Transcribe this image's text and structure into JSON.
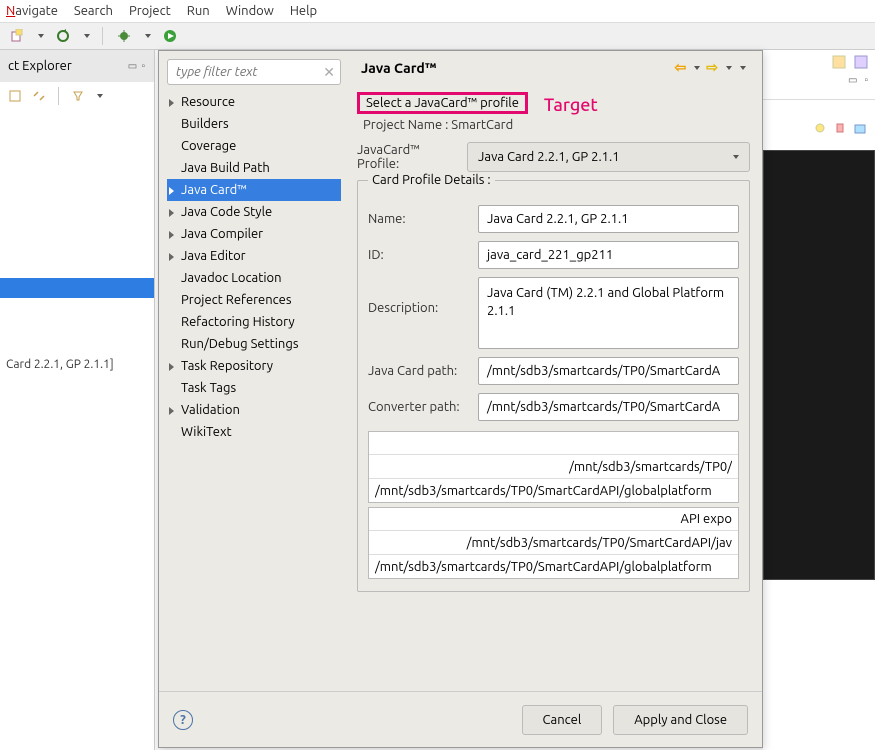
{
  "menubar": [
    "Navigate",
    "Search",
    "Project",
    "Run",
    "Window",
    "Help"
  ],
  "left_panel": {
    "title": "ct Explorer",
    "visible_line": "Card 2.2.1, GP 2.1.1]"
  },
  "dialog": {
    "filter_placeholder": "type filter text",
    "tree": [
      {
        "label": "Resource",
        "expandable": true
      },
      {
        "label": "Builders",
        "expandable": false
      },
      {
        "label": "Coverage",
        "expandable": false
      },
      {
        "label": "Java Build Path",
        "expandable": false
      },
      {
        "label": "Java Card™",
        "expandable": true,
        "selected": true
      },
      {
        "label": "Java Code Style",
        "expandable": true
      },
      {
        "label": "Java Compiler",
        "expandable": true
      },
      {
        "label": "Java Editor",
        "expandable": true
      },
      {
        "label": "Javadoc Location",
        "expandable": false
      },
      {
        "label": "Project References",
        "expandable": false
      },
      {
        "label": "Refactoring History",
        "expandable": false
      },
      {
        "label": "Run/Debug Settings",
        "expandable": false
      },
      {
        "label": "Task Repository",
        "expandable": true
      },
      {
        "label": "Task Tags",
        "expandable": false
      },
      {
        "label": "Validation",
        "expandable": true
      },
      {
        "label": "WikiText",
        "expandable": false
      }
    ],
    "right": {
      "title": "Java Card™",
      "subtitle": "Select a JavaCard™ profile",
      "target_badge": "Target",
      "project_name_label": "Project Name : SmartCard",
      "profile_label": "JavaCard™ Profile:",
      "profile_value": "Java Card 2.2.1, GP 2.1.1",
      "details_legend": "Card Profile Details :",
      "fields": {
        "name_label": "Name:",
        "name_value": "Java Card 2.2.1, GP 2.1.1",
        "id_label": "ID:",
        "id_value": "java_card_221_gp211",
        "desc_label": "Description:",
        "desc_value": "Java Card (TM) 2.2.1 and Global Platform 2.1.1",
        "jc_path_label": "Java Card path:",
        "jc_path_value": "/mnt/sdb3/smartcards/TP0/SmartCardA",
        "conv_path_label": "Converter path:",
        "conv_path_value": "/mnt/sdb3/smartcards/TP0/SmartCardA"
      },
      "path_list_1": [
        "/mnt/sdb3/smartcards/TP0/",
        "/mnt/sdb3/smartcards/TP0/SmartCardAPI/globalplatform"
      ],
      "path_list_2_header": "API expo",
      "path_list_2": [
        "/mnt/sdb3/smartcards/TP0/SmartCardAPI/jav",
        "/mnt/sdb3/smartcards/TP0/SmartCardAPI/globalplatform"
      ]
    },
    "footer": {
      "cancel": "Cancel",
      "apply": "Apply and Close"
    }
  }
}
